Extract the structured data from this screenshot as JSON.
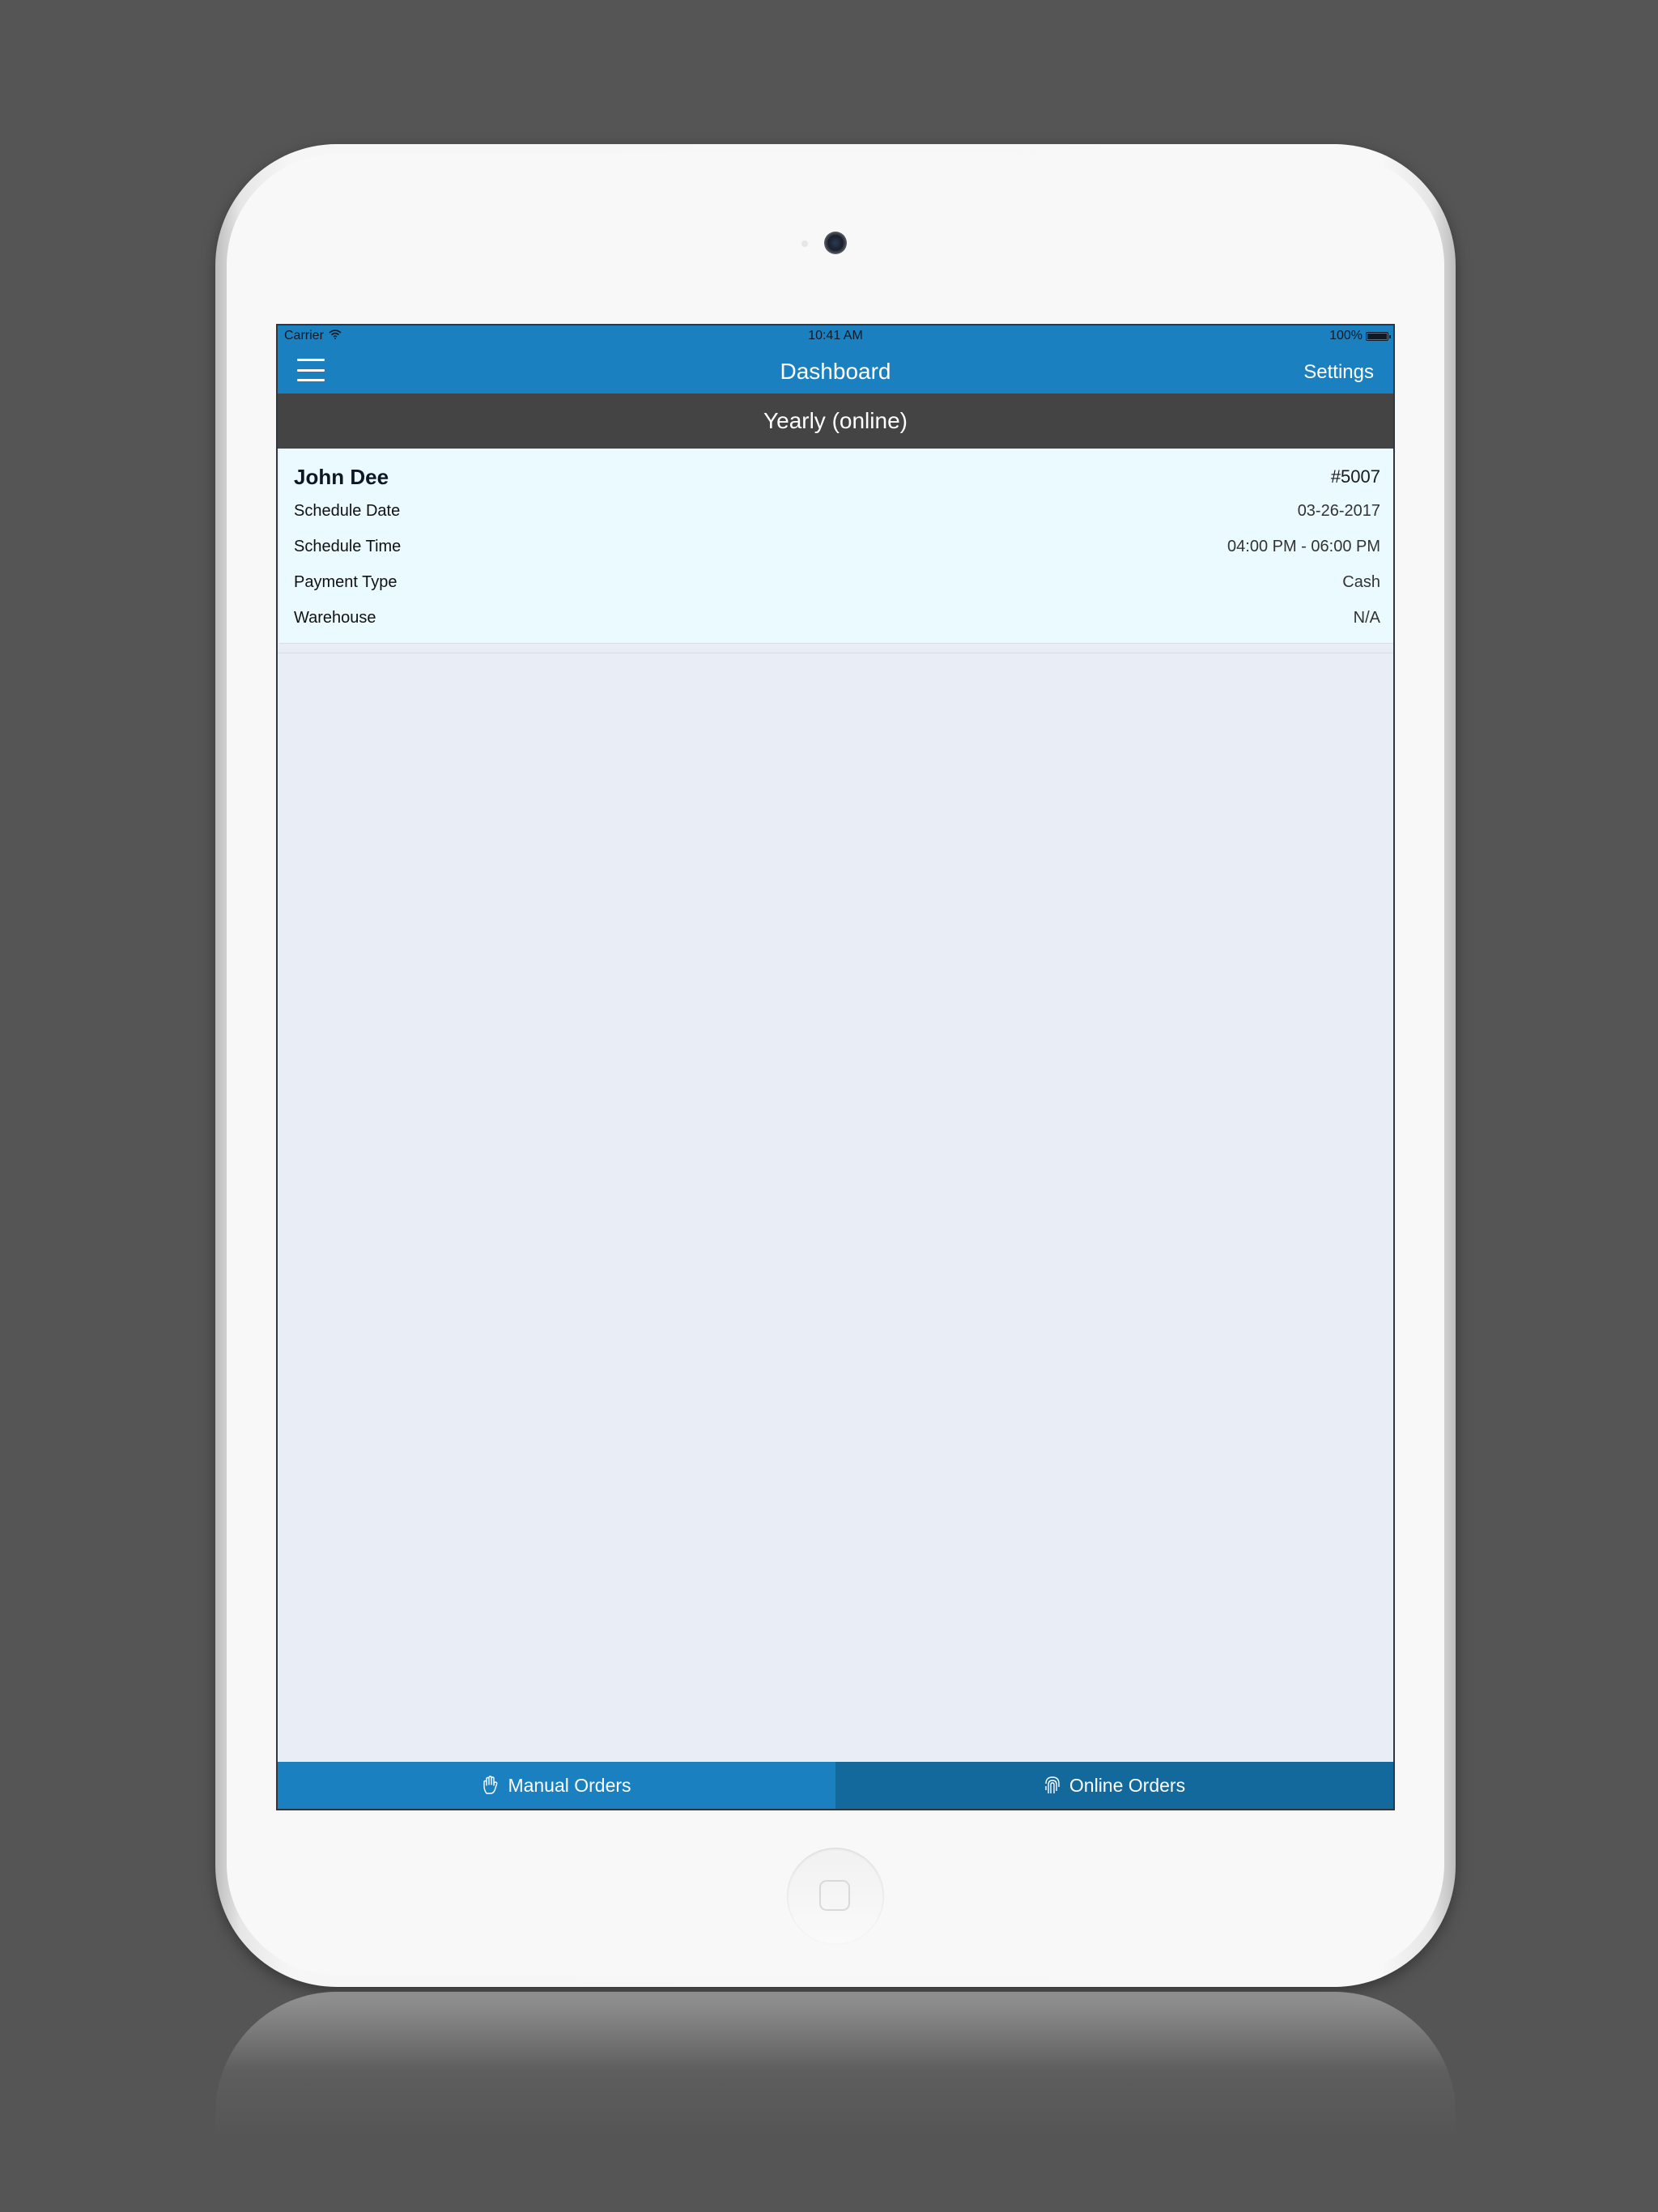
{
  "status_bar": {
    "carrier": "Carrier",
    "time": "10:41 AM",
    "battery": "100%",
    "battery_level": 1.0
  },
  "nav": {
    "title": "Dashboard",
    "settings_label": "Settings",
    "menu_icon": "hamburger-menu-icon"
  },
  "section": {
    "title": "Yearly (online)"
  },
  "order": {
    "customer": "John Dee",
    "number": "#5007",
    "rows": [
      {
        "label": "Schedule Date",
        "value": "03-26-2017"
      },
      {
        "label": "Schedule Time",
        "value": "04:00 PM - 06:00 PM"
      },
      {
        "label": "Payment Type",
        "value": "Cash"
      },
      {
        "label": "Warehouse",
        "value": "N/A"
      }
    ]
  },
  "tabs": [
    {
      "label": "Manual Orders",
      "icon": "hand-icon"
    },
    {
      "label": "Online Orders",
      "icon": "fingerprint-icon"
    }
  ],
  "colors": {
    "primary": "#1b80bf",
    "primary_dark": "#13689c",
    "header_dark": "#444444",
    "card_bg": "#eafaff",
    "screen_bg": "#e9edf5",
    "background": "#555555"
  }
}
